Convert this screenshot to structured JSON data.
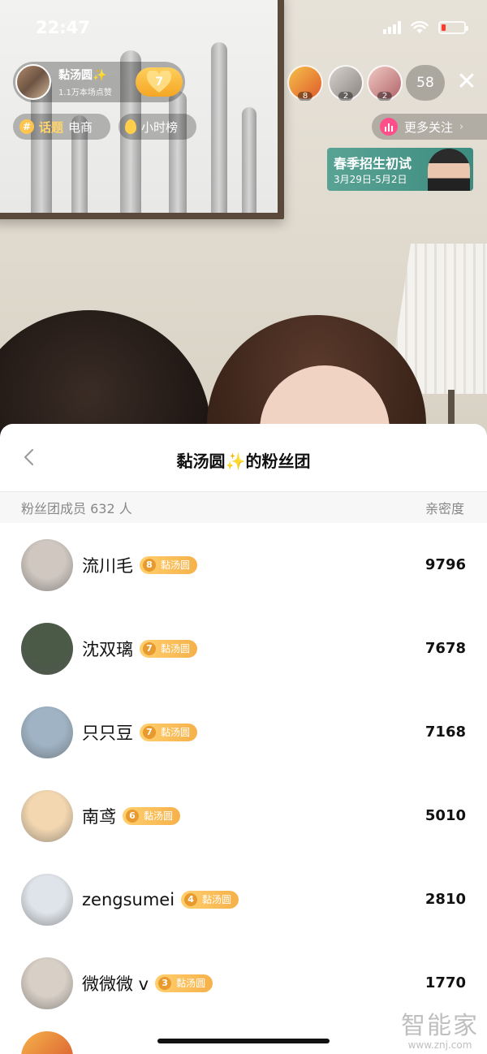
{
  "status_bar": {
    "time": "22:47"
  },
  "streamer": {
    "name": "黏汤圆✨",
    "likes": "1.1万本场点赞",
    "fan_level": "7"
  },
  "tags": {
    "topic_prefix": "话题",
    "topic_name": "电商",
    "hourly_rank": "小时榜"
  },
  "viewers": {
    "badges": [
      "8",
      "2",
      "2"
    ],
    "count": "58"
  },
  "follow_more": "更多关注",
  "banner": {
    "title": "春季招生初试",
    "date": "3月29日-5月2日"
  },
  "sheet": {
    "title": "黏汤圆✨的粉丝团",
    "members_label": "粉丝团成员 632 人",
    "intimacy_label": "亲密度",
    "members": [
      {
        "name": "流川毛",
        "level": "8",
        "club": "黏汤圆",
        "score": "9796",
        "avatar_color": "#cfc7c0"
      },
      {
        "name": "沈双璃",
        "level": "7",
        "club": "黏汤圆",
        "score": "7678",
        "avatar_color": "#4b5a47"
      },
      {
        "name": "只只豆",
        "level": "7",
        "club": "黏汤圆",
        "score": "7168",
        "avatar_color": "#9fb3c4"
      },
      {
        "name": "南鸢",
        "level": "6",
        "club": "黏汤圆",
        "score": "5010",
        "avatar_color": "#f3d7b0"
      },
      {
        "name": "zengsumei",
        "level": "4",
        "club": "黏汤圆",
        "score": "2810",
        "avatar_color": "#dfe4ea"
      },
      {
        "name": "微微微 v",
        "level": "3",
        "club": "黏汤圆",
        "score": "1770",
        "avatar_color": "#d8cfc6"
      }
    ]
  },
  "watermark": {
    "brand": "智能家",
    "url": "www.znj.com"
  }
}
